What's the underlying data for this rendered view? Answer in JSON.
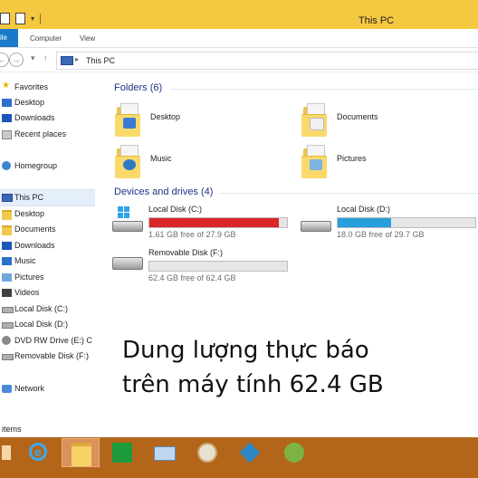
{
  "window": {
    "title": "This PC"
  },
  "ribbon": {
    "file_label": "ile",
    "tabs": [
      "Computer",
      "View"
    ]
  },
  "navbar": {
    "address": "This PC"
  },
  "sidebar": {
    "items": [
      {
        "label": "Favorites",
        "icon": "star-icon"
      },
      {
        "label": "Desktop",
        "icon": "desktop-icon"
      },
      {
        "label": "Downloads",
        "icon": "downloads-icon"
      },
      {
        "label": "Recent places",
        "icon": "recent-places-icon"
      },
      {
        "label": "Homegroup",
        "icon": "homegroup-icon"
      },
      {
        "label": "This PC",
        "icon": "this-pc-icon"
      },
      {
        "label": "Desktop",
        "icon": "desktop-folder-icon"
      },
      {
        "label": "Documents",
        "icon": "documents-folder-icon"
      },
      {
        "label": "Downloads",
        "icon": "downloads-folder-icon"
      },
      {
        "label": "Music",
        "icon": "music-folder-icon"
      },
      {
        "label": "Pictures",
        "icon": "pictures-folder-icon"
      },
      {
        "label": "Videos",
        "icon": "videos-folder-icon"
      },
      {
        "label": "Local Disk (C:)",
        "icon": "disk-icon"
      },
      {
        "label": "Local Disk (D:)",
        "icon": "disk-icon"
      },
      {
        "label": "DVD RW Drive (E:) C",
        "icon": "dvd-drive-icon"
      },
      {
        "label": "Removable Disk (F:)",
        "icon": "removable-disk-icon"
      },
      {
        "label": "Network",
        "icon": "network-icon"
      }
    ]
  },
  "main": {
    "folders_header": "Folders (6)",
    "folders": [
      {
        "name": "Desktop",
        "icon": "desktop-folder-icon"
      },
      {
        "name": "Documents",
        "icon": "documents-folder-icon"
      },
      {
        "name": "Music",
        "icon": "music-folder-icon"
      },
      {
        "name": "Pictures",
        "icon": "pictures-folder-icon"
      }
    ],
    "drives_header": "Devices and drives (4)",
    "drives": [
      {
        "name": "Local Disk (C:)",
        "free": "1.61 GB free of 27.9 GB",
        "used_fraction": 0.94,
        "bar_color": "#da2626",
        "icon": "windows-drive-icon"
      },
      {
        "name": "Local Disk (D:)",
        "free": "18.0 GB free of 29.7 GB",
        "used_fraction": 0.39,
        "bar_color": "#26a0da",
        "icon": "hard-drive-icon"
      },
      {
        "name": "Removable Disk (F:)",
        "free": "62.4 GB free of 62.4 GB",
        "used_fraction": 0.0,
        "bar_color": "#26a0da",
        "icon": "removable-drive-icon"
      }
    ]
  },
  "overlay": {
    "line1": "Dung lượng thực báo",
    "line2": "trên máy tính 62.4 GB"
  },
  "statusbar": {
    "text": "items"
  },
  "taskbar": {
    "buttons": [
      "start-icon",
      "internet-explorer-icon",
      "file-explorer-icon",
      "store-icon",
      "keyboard-icon",
      "paint-icon",
      "kodi-icon",
      "app-icon"
    ]
  },
  "colors": {
    "accent": "#1979ca",
    "title_bar": "#f4c840",
    "taskbar": "#b3661a",
    "section_text": "#1e3287"
  }
}
